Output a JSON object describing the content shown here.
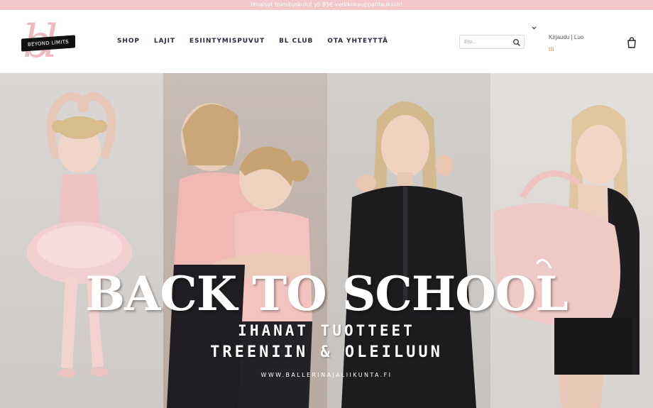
{
  "promo": {
    "text": "Ilmaiset toimituskulut yli 85€ verkkokauppatilauksiin!"
  },
  "brand": {
    "name": "BEYOND LIMITS",
    "script_letters": "bl"
  },
  "nav": [
    {
      "label": "SHOP"
    },
    {
      "label": "LAJIT"
    },
    {
      "label": "ESIINTYMISPUVUT"
    },
    {
      "label": "BL CLUB"
    },
    {
      "label": "OTA YHTEYTTÄ"
    }
  ],
  "search": {
    "placeholder": "Etsi..."
  },
  "account": {
    "login": "Kirjaudu",
    "separator": " | ",
    "create": "Luo",
    "create2": "tili"
  },
  "hero": {
    "headline": "BACK TO SCHOOL",
    "sub1": "IHANAT TUOTTEET",
    "sub2": "TREENIIN & OLEILUUN",
    "url": "WWW.BALLERINAJALIIKUNTA.FI"
  },
  "colors": {
    "promo_bg": "#f2c6cb",
    "logo_pink": "#efb9c1",
    "nav_text": "#2a2a3a",
    "accent_gold": "#c89a3a"
  },
  "icons": {
    "search": "search-icon",
    "cart": "cart-icon",
    "chevron": "chevron-down-icon"
  }
}
